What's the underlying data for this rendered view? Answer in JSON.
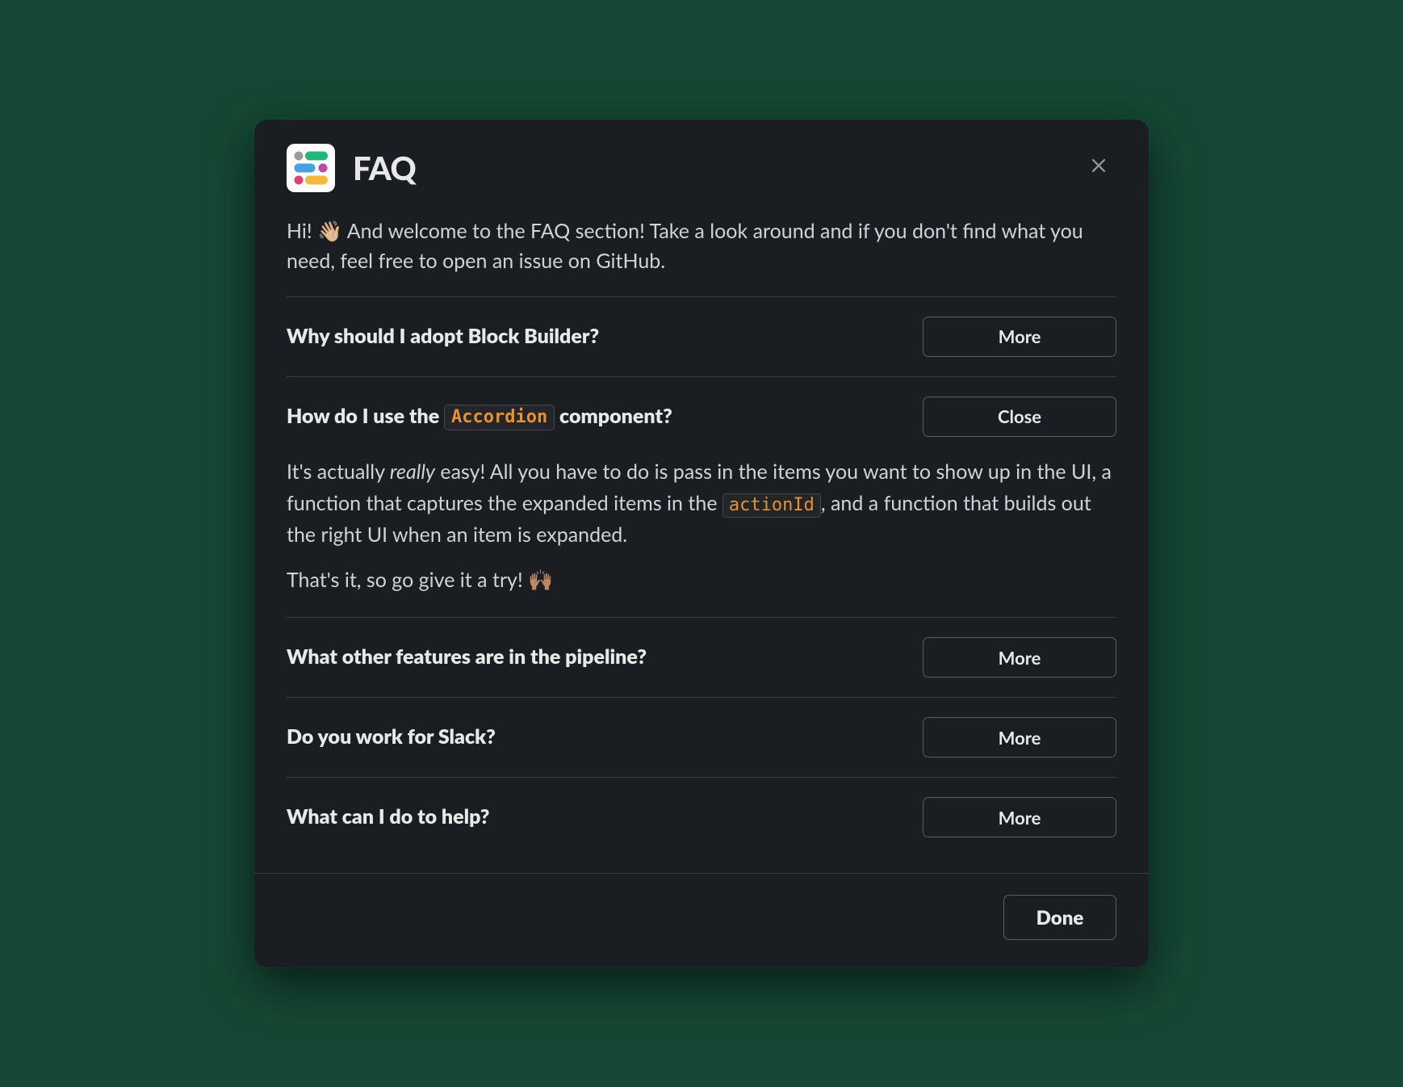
{
  "header": {
    "title": "FAQ"
  },
  "intro": {
    "prefix": "Hi! ",
    "wave_emoji": "👋🏼",
    "rest": " And welcome to the FAQ section! Take a look around and if you don't find what you need, feel free to open an issue on GitHub."
  },
  "buttons": {
    "more": "More",
    "close": "Close",
    "done": "Done"
  },
  "items": [
    {
      "title_plain": "Why should I adopt Block Builder?",
      "button": "more"
    },
    {
      "title_prefix": "How do I use the ",
      "title_code": "Accordion",
      "title_suffix": " component?",
      "button": "close",
      "expanded": {
        "p1_a": "It's actually ",
        "p1_em": "really",
        "p1_b": " easy! All you have to do is pass in the items you want to show up in the UI, a function that captures the expanded items in the ",
        "p1_code": "actionId",
        "p1_c": ", and a function that builds out the right UI when an item is expanded.",
        "p2_a": "That's it, so go give it a try!  ",
        "p2_emoji": "🙌🏽"
      }
    },
    {
      "title_plain": "What other features are in the pipeline?",
      "button": "more"
    },
    {
      "title_plain": "Do you work for Slack?",
      "button": "more"
    },
    {
      "title_plain": "What can I do to help?",
      "button": "more"
    }
  ]
}
